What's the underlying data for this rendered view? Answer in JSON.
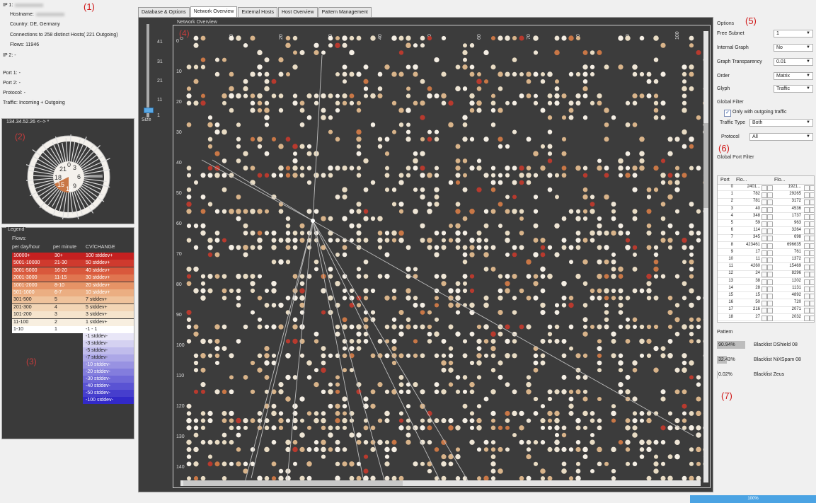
{
  "info": {
    "ip1_label": "IP 1:",
    "hostname_label": "Hostname:",
    "country": "Country: DE, Germany",
    "connections": "Connections to 258 distinct Hosts( 221 Outgoing)",
    "flows": "Flows: 11946",
    "ip2": "IP 2: -",
    "port1": "Port 1: -",
    "port2": "Port 2: -",
    "protocol": "Protocol: -",
    "traffic": "Traffic: Incoming + Outgoing",
    "annotation": "(1)"
  },
  "glyph_panel": {
    "title": "134.34.52.26 <--> *",
    "annotation": "(2)",
    "glyph_numbers": [
      "21",
      "0",
      "3",
      "6",
      "9",
      "12",
      "15",
      "18"
    ]
  },
  "legend": {
    "title": "Legend",
    "flows_label": "Flows:",
    "col_headers": [
      "per day/hour",
      "per minute",
      "CV/CHANGE"
    ],
    "rows": [
      {
        "a": "10000+",
        "b": "30+",
        "c": "100 stddev+",
        "color": "#c42020",
        "fg": "#fff"
      },
      {
        "a": "5001-10000",
        "b": "21-30",
        "c": "50 stddev+",
        "color": "#cf3a2e",
        "fg": "#fff"
      },
      {
        "a": "3001-5000",
        "b": "16-20",
        "c": "40 stddev+",
        "color": "#d9583c",
        "fg": "#fff"
      },
      {
        "a": "2001-3000",
        "b": "11-15",
        "c": "30 stddev+",
        "color": "#e07550",
        "fg": "#fff"
      },
      {
        "a": "1001-2000",
        "b": "8-10",
        "c": "20 stddev+",
        "color": "#e69366",
        "fg": "#fff"
      },
      {
        "a": "501-1000",
        "b": "6-7",
        "c": "10 stddev+",
        "color": "#ebae82",
        "fg": "#fff"
      },
      {
        "a": "301-500",
        "b": "5",
        "c": "7 stddev+",
        "color": "#efc39c",
        "fg": "#222"
      },
      {
        "a": "201-300",
        "b": "4",
        "c": "5 stddev+",
        "color": "#f2d5b5",
        "fg": "#222"
      },
      {
        "a": "101-200",
        "b": "3",
        "c": "3 stddev+",
        "color": "#f5e4cc",
        "fg": "#222"
      },
      {
        "a": "11-100",
        "b": "2",
        "c": "1 stddev+",
        "color": "#f8efe0",
        "fg": "#222"
      },
      {
        "a": "1-10",
        "b": "1",
        "c": "-1 - 1",
        "color": "#ffffff",
        "fg": "#222"
      }
    ],
    "neg_rows": [
      {
        "c": "-1 stddev-",
        "color": "#e8e6f7"
      },
      {
        "c": "-3 stddev-",
        "color": "#d4d1f1"
      },
      {
        "c": "-5 stddev-",
        "color": "#c0bcec"
      },
      {
        "c": "-7 stddev-",
        "color": "#aca7e7"
      },
      {
        "c": "-10 stddev-",
        "color": "#9892e2"
      },
      {
        "c": "-20 stddev-",
        "color": "#837ddd"
      },
      {
        "c": "-30 stddev-",
        "color": "#6f68d8"
      },
      {
        "c": "-40 stddev-",
        "color": "#5a53d3"
      },
      {
        "c": "-50 stddev-",
        "color": "#463ecd"
      },
      {
        "c": "-100 stddev-",
        "color": "#3229c8"
      }
    ],
    "annotation": "(3)"
  },
  "tabs": [
    "Database & Options",
    "Network Overview",
    "External Hosts",
    "Host Overview",
    "Pattern Management"
  ],
  "active_tab": 1,
  "size_slider": {
    "ticks": [
      "41",
      "31",
      "21",
      "11",
      "1"
    ],
    "label": "Size"
  },
  "overview": {
    "title": "Network Overview",
    "annotation": "(4)",
    "col_labels": [
      "0",
      "10",
      "20",
      "30",
      "40",
      "50",
      "60",
      "70",
      "80",
      "90",
      "100"
    ],
    "row_labels": [
      "0",
      "10",
      "20",
      "30",
      "40",
      "50",
      "60",
      "70",
      "80",
      "90",
      "100",
      "110",
      "120",
      "130",
      "140"
    ]
  },
  "options": {
    "title": "Options",
    "annotation": "(5)",
    "fields": [
      {
        "label": "Free Subnet",
        "value": "1"
      },
      {
        "label": "Internal Graph",
        "value": "No"
      },
      {
        "label": "Graph Transparency",
        "value": "0.01"
      },
      {
        "label": "Order",
        "value": "Matrix"
      },
      {
        "label": "Glyph",
        "value": "Traffic"
      }
    ],
    "global_filter": "Global Filter",
    "only_outgoing": "Only with outgoing traffic",
    "traffic_type_label": "Traffic Type",
    "traffic_type_value": "Both",
    "protocol_label": "Protocol",
    "protocol_value": "All"
  },
  "port_filter": {
    "title": "Global Port Filter",
    "annotation": "(6)",
    "headers": [
      "Port",
      "Flo...",
      "Flo..."
    ],
    "rows": [
      [
        "0",
        "2401...",
        "1921..."
      ],
      [
        "1",
        "782",
        "29265"
      ],
      [
        "2",
        "781",
        "3172"
      ],
      [
        "3",
        "40",
        "4536"
      ],
      [
        "4",
        "348",
        "1737"
      ],
      [
        "5",
        "59",
        "963"
      ],
      [
        "6",
        "114",
        "3264"
      ],
      [
        "7",
        "345",
        "698"
      ],
      [
        "8",
        "423461",
        "696635"
      ],
      [
        "9",
        "17",
        "761"
      ],
      [
        "10",
        "11",
        "1372"
      ],
      [
        "11",
        "4260",
        "15469"
      ],
      [
        "12",
        "24",
        "8296"
      ],
      [
        "13",
        "38",
        "1202"
      ],
      [
        "14",
        "28",
        "1131"
      ],
      [
        "15",
        "15",
        "4892"
      ],
      [
        "16",
        "50",
        "720"
      ],
      [
        "17",
        "216",
        "2071"
      ],
      [
        "18",
        "27",
        "2032"
      ]
    ]
  },
  "pattern": {
    "title": "Pattern",
    "annotation": "(7)",
    "rows": [
      {
        "pct": "90.94%",
        "name": "Blacklist DShield 08",
        "frac": 0.9094
      },
      {
        "pct": "32.43%",
        "name": "Blacklist NiXSpam 08",
        "frac": 0.3243
      },
      {
        "pct": "0.02%",
        "name": "Blacklist Zeus",
        "frac": 0.0002
      }
    ]
  },
  "status": {
    "progress": "100%"
  },
  "colors": {
    "panel_dark": "#3c3c3c",
    "accent": "#4ba3e3",
    "annotation": "#d01818"
  }
}
